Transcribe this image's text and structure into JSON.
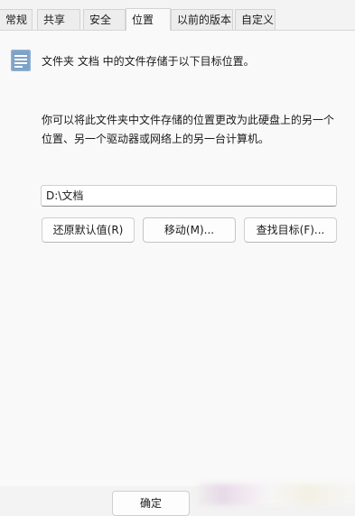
{
  "tabs": [
    {
      "label": "常规"
    },
    {
      "label": "共享"
    },
    {
      "label": "安全"
    },
    {
      "label": "位置"
    },
    {
      "label": "以前的版本"
    },
    {
      "label": "自定义"
    }
  ],
  "active_tab": "位置",
  "location": {
    "description": "文件夹 文档 中的文件存储于以下目标位置。",
    "instruction": "你可以将此文件夹中文件存储的位置更改为此硬盘上的另一个位置、另一个驱动器或网络上的另一台计算机。",
    "path_value": "D:\\文档",
    "restore_label": "还原默认值(R)",
    "move_label": "移动(M)...",
    "find_target_label": "查找目标(F)..."
  },
  "footer": {
    "ok_label": "确定"
  },
  "icons": {
    "folder": "document-folder-icon"
  },
  "colors": {
    "icon_blue": "#7da2c7",
    "background": "#f9f9f9",
    "tab_bg": "#ededed"
  }
}
